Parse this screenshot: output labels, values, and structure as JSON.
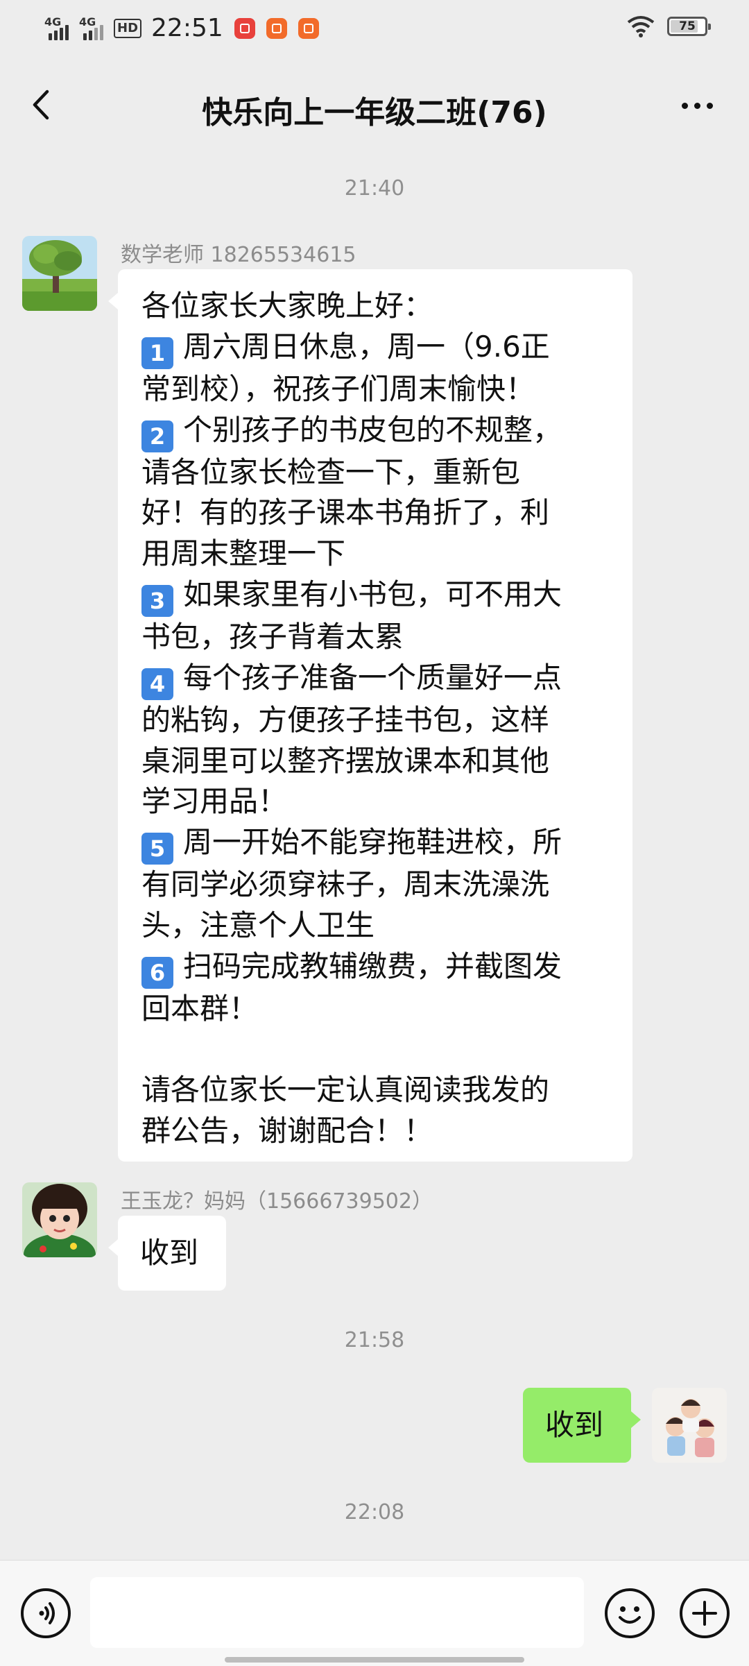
{
  "status_bar": {
    "signal1_label": "4G",
    "signal2_label": "4G",
    "hd_label": "HD",
    "time": "22:51",
    "battery": "75"
  },
  "header": {
    "title": "快乐向上一年级二班(76)"
  },
  "chat": {
    "timestamps": [
      "21:40",
      "21:58",
      "22:08"
    ],
    "teacher": {
      "sender": "数学老师  18265534615",
      "lines": [
        "各位家长大家晚上好：",
        "周六周日休息，周一（9.6正",
        "常到校），祝孩子们周末愉快！",
        "个别孩子的书皮包的不规整，",
        "请各位家长检查一下，重新包",
        "好！有的孩子课本书角折了，利",
        "用周末整理一下",
        "如果家里有小书包，可不用大",
        "书包，孩子背着太累",
        "每个孩子准备一个质量好一点",
        "的粘钩，方便孩子挂书包，这样",
        "桌洞里可以整齐摆放课本和其他",
        "学习用品！",
        "周一开始不能穿拖鞋进校，所",
        "有同学必须穿袜子，周末洗澡洗",
        "头，注意个人卫生",
        "扫码完成教辅缴费，并截图发",
        "回本群！",
        "请各位家长一定认真阅读我发的",
        "群公告，谢谢配合！！"
      ],
      "badges": [
        "1",
        "2",
        "3",
        "4",
        "5",
        "6"
      ]
    },
    "parent": {
      "sender": "王玉龙？妈妈（15666739502）",
      "text": "收到"
    },
    "me": {
      "text": "收到"
    }
  },
  "input_bar": {
    "voice_icon": "voice-icon",
    "emoji_icon": "emoji-icon",
    "plus_icon": "plus-icon"
  },
  "colors": {
    "background": "#ededed",
    "my_bubble": "#95ec69",
    "other_bubble": "#ffffff",
    "badge": "#3d85e0"
  }
}
